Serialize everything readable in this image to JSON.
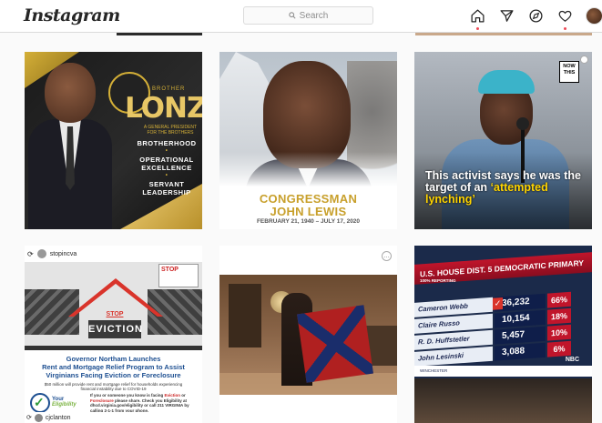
{
  "header": {
    "logo": "Instagram",
    "search_placeholder": "Search",
    "nav_icons": [
      "home-icon",
      "direct-icon",
      "explore-icon",
      "heart-icon",
      "profile-avatar"
    ]
  },
  "posts": [
    {
      "brother": "BROTHER",
      "headline": "LONZER",
      "sub": "A GENERAL PRESIDENT FOR THE BROTHERS",
      "list": [
        "BROTHERHOOD",
        "OPERATIONAL EXCELLENCE",
        "SERVANT LEADERSHIP"
      ]
    },
    {
      "line1": "CONGRESSMAN",
      "line2": "JOHN LEWIS",
      "dates": "FEBRUARY 21, 1940 – JULY 17, 2020"
    },
    {
      "badge_line1": "NOW",
      "badge_line2": "THIS",
      "caption_prefix": "This activist says he was the target of an ",
      "caption_highlight": "‘attempted lynching’"
    },
    {
      "repost_user": "stopincva",
      "badge": "STOP",
      "stop_label": "STOP",
      "banner": "EVICTION",
      "heading_line1": "Governor Northam Launches",
      "heading_line2": "Rent and Mortgage Relief Program to Assist",
      "heading_line3": "Virginians Facing Eviction or Foreclosure",
      "detail1": "$50 million will provide rent and mortgage relief for households experiencing financial instability due to COVID-19",
      "detail2_a": "If you or someone you know is facing ",
      "detail2_eviction": "Eviction",
      "detail2_b": " or ",
      "detail2_foreclosure": "Foreclosure",
      "detail2_c": " please share. Check you Eligibility at dhcd.virginia.gov/eligibility or call 211 VIRGINIA by calling 2-1-1 from your phone.",
      "eligibility_line1": "Your",
      "eligibility_line2": "Eligibility",
      "footer_user": "cjclanton"
    },
    {
      "menu_label": "…"
    },
    {
      "title": "U.S. HOUSE DIST. 5 DEMOCRATIC PRIMARY",
      "reporting": "100% REPORTING",
      "candidates": [
        {
          "name": "Cameron Webb",
          "votes": "36,232",
          "pct": "66%",
          "winner": true
        },
        {
          "name": "Claire Russo",
          "votes": "10,154",
          "pct": "18%",
          "winner": false
        },
        {
          "name": "R. D. Huffstetler",
          "votes": "5,457",
          "pct": "10%",
          "winner": false
        },
        {
          "name": "John Lesinski",
          "votes": "3,088",
          "pct": "6%",
          "winner": false
        }
      ],
      "bottom_text": "WINCHESTER",
      "network": "NBC"
    }
  ]
}
